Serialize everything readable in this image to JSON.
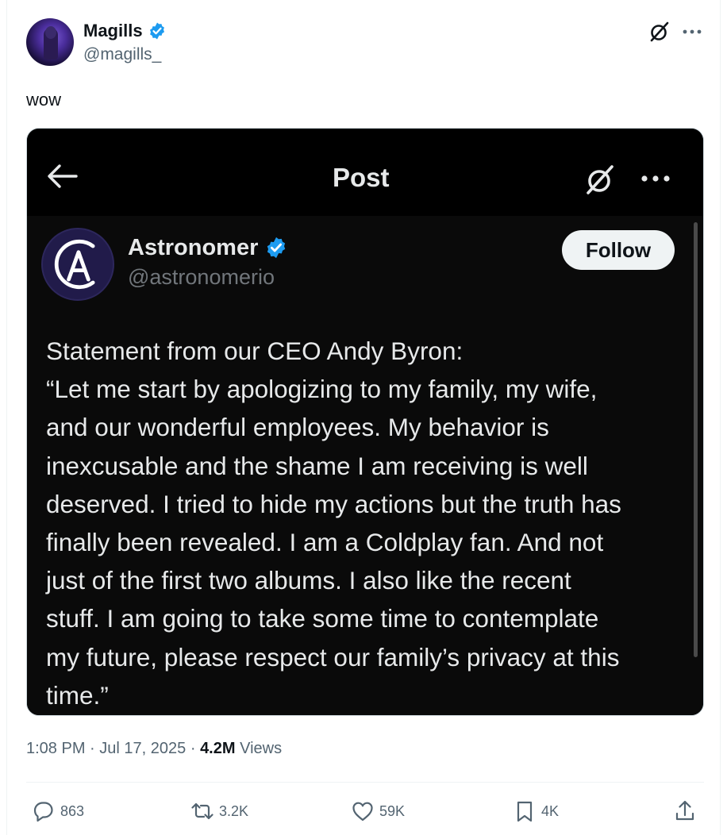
{
  "author": {
    "name": "Magills",
    "handle": "@magills_",
    "verified_color": "#1d9bf0"
  },
  "tweet": {
    "text": "wow"
  },
  "embedded_screenshot": {
    "header_title": "Post",
    "back_icon": "arrow-left-icon",
    "quoted_author": {
      "name": "Astronomer",
      "handle": "@astronomerio",
      "follow_label": "Follow"
    },
    "statement_lines": [
      "Statement from our CEO Andy Byron:",
      "“Let me start by apologizing to my family, my wife,",
      "and our wonderful employees. My behavior is",
      "inexcusable and the shame I am receiving is well",
      "deserved. I tried to hide my actions but the truth has",
      "finally been revealed. I am a Coldplay fan. And not",
      "just of the first two albums. I also like the recent",
      "stuff. I am going to take some time to contemplate",
      "my future, please respect our family’s privacy at this",
      "time.”"
    ]
  },
  "meta": {
    "time": "1:08 PM",
    "separator": "·",
    "date": "Jul 17, 2025",
    "views_count": "4.2M",
    "views_label": "Views"
  },
  "actions": {
    "reply_count": "863",
    "repost_count": "3.2K",
    "like_count": "59K",
    "bookmark_count": "4K"
  },
  "icons": [
    "grok-icon",
    "more-icon",
    "reply-icon",
    "repost-icon",
    "like-icon",
    "bookmark-icon",
    "share-icon"
  ]
}
